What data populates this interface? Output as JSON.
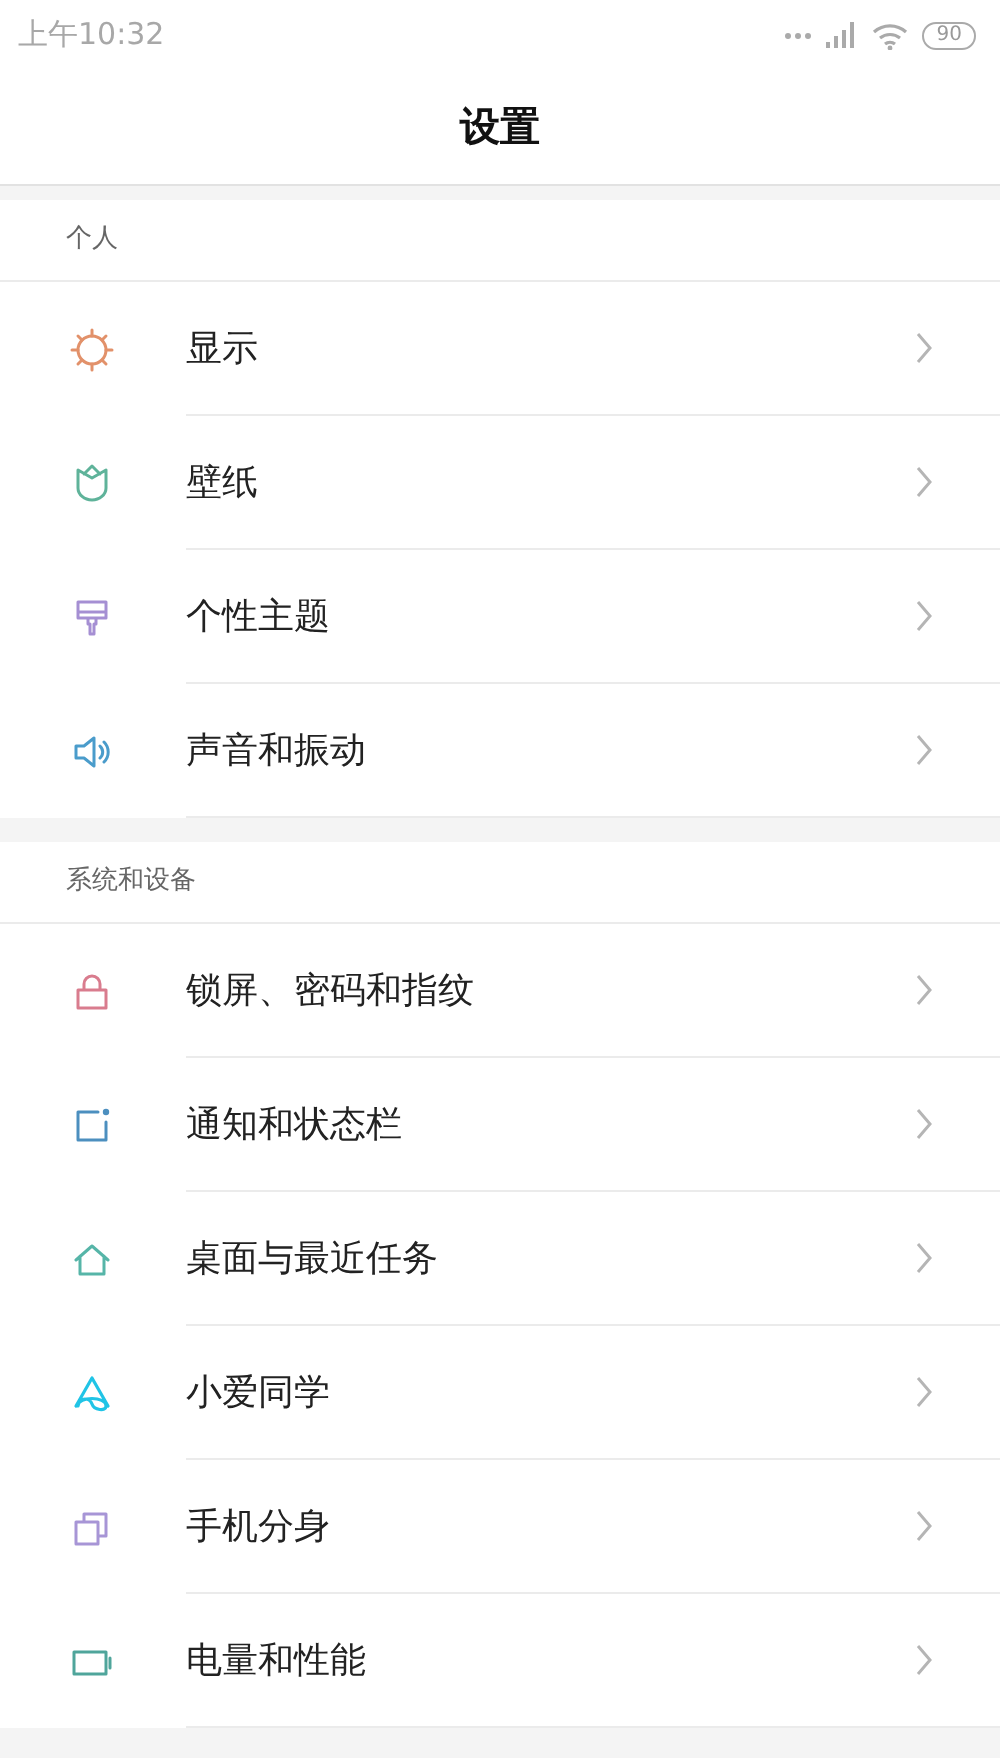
{
  "status_bar": {
    "time": "上午10:32",
    "battery": "90"
  },
  "header": {
    "title": "设置"
  },
  "sections": [
    {
      "title": "个人",
      "items": [
        {
          "label": "显示"
        },
        {
          "label": "壁纸"
        },
        {
          "label": "个性主题"
        },
        {
          "label": "声音和振动"
        }
      ]
    },
    {
      "title": "系统和设备",
      "items": [
        {
          "label": "锁屏、密码和指纹"
        },
        {
          "label": "通知和状态栏"
        },
        {
          "label": "桌面与最近任务"
        },
        {
          "label": "小爱同学"
        },
        {
          "label": "手机分身"
        },
        {
          "label": "电量和性能"
        }
      ]
    }
  ]
}
